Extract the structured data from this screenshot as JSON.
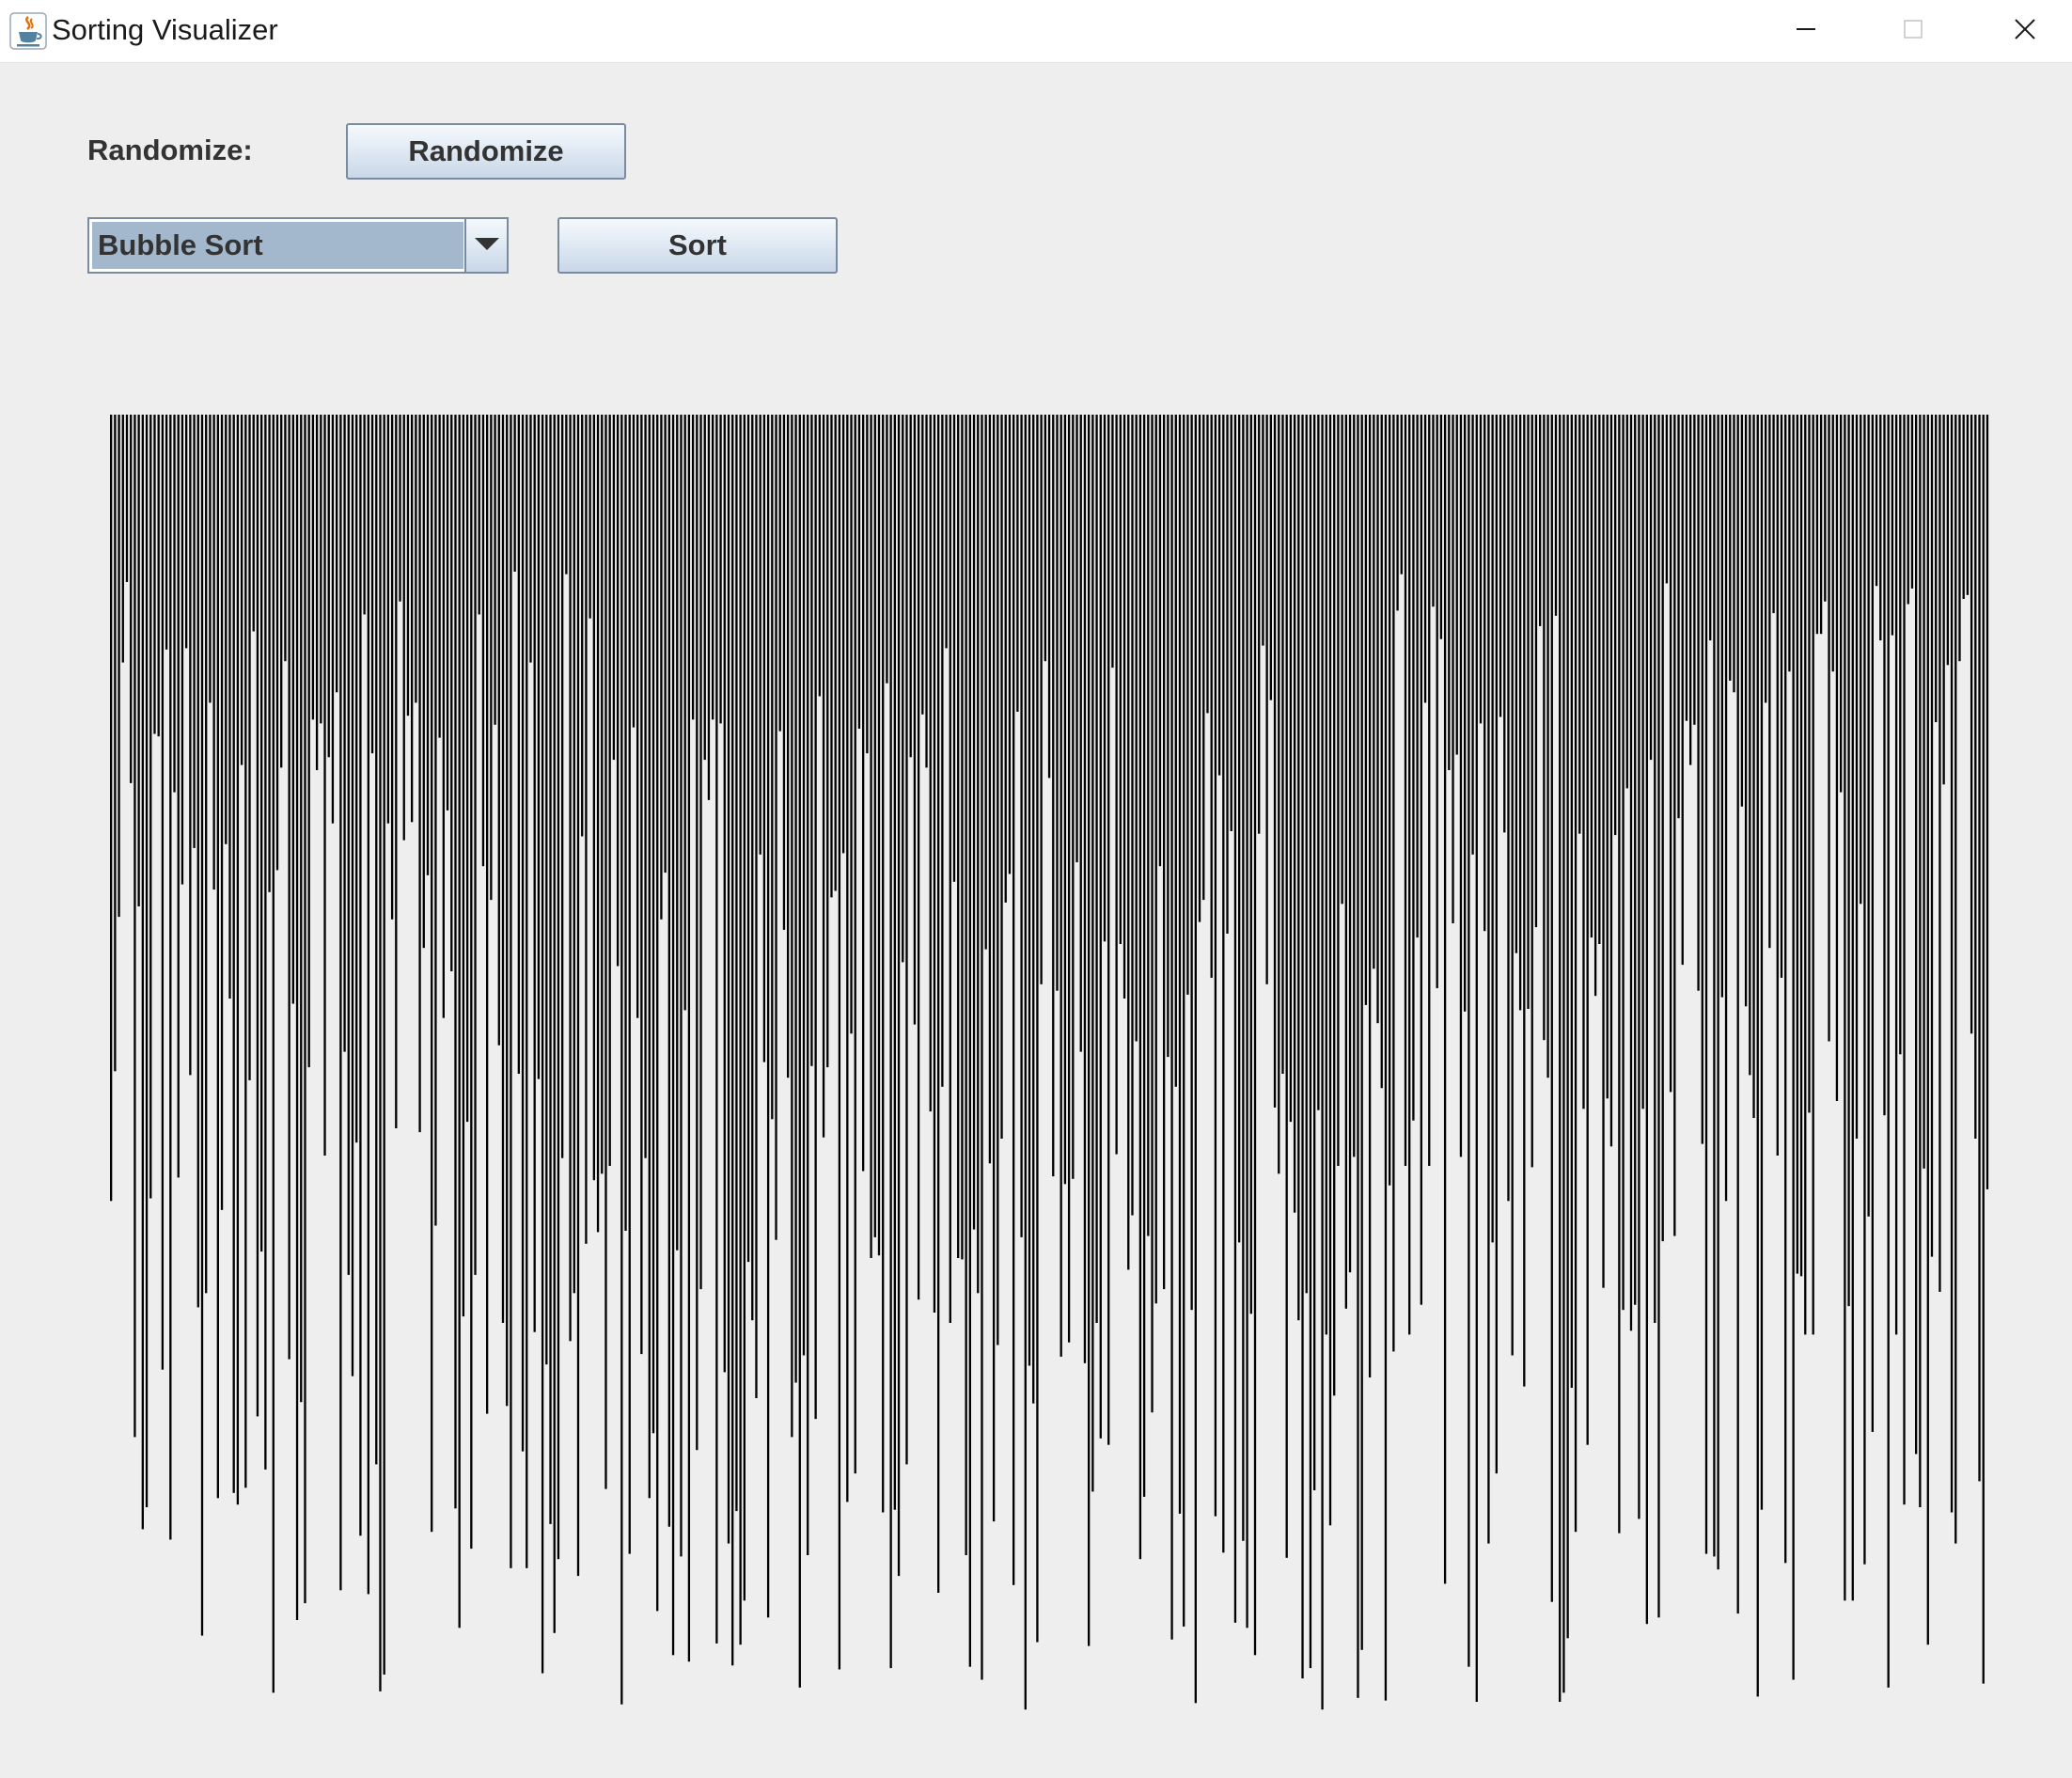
{
  "window": {
    "title": "Sorting Visualizer",
    "app_icon": "java-cup-icon",
    "controls": [
      "minimize-icon",
      "maximize-icon",
      "close-icon"
    ]
  },
  "controls": {
    "randomize_label": "Randomize:",
    "randomize_button": "Randomize",
    "algorithm_selected": "Bubble Sort",
    "sort_button": "Sort"
  },
  "visualizer": {
    "bar_color": "#000000",
    "background": "#eeeeee",
    "bar_count": 475,
    "max_value": 1000,
    "orientation": "bars hang downward from a common top baseline",
    "seed": 20240517
  },
  "colors": {
    "window_bg": "#eeeeee",
    "combo_selection": "#a3b8cc",
    "button_border": "#7a8a9f"
  }
}
